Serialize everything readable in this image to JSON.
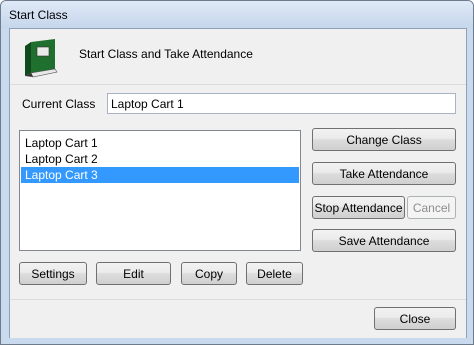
{
  "window": {
    "title": "Start Class"
  },
  "header": {
    "title": "Start Class and Take Attendance",
    "icon": "book-icon"
  },
  "current_class": {
    "label": "Current Class",
    "value": "Laptop Cart 1"
  },
  "class_list": {
    "items": [
      {
        "label": "Laptop Cart 1",
        "selected": false
      },
      {
        "label": "Laptop Cart 2",
        "selected": false
      },
      {
        "label": "Laptop Cart 3",
        "selected": true
      }
    ]
  },
  "actions": {
    "change_class": "Change Class",
    "take_attendance": "Take Attendance",
    "stop_attendance": "Stop Attendance",
    "cancel": "Cancel",
    "save_attendance": "Save Attendance"
  },
  "list_buttons": {
    "settings": "Settings",
    "edit": "Edit",
    "copy": "Copy",
    "delete": "Delete"
  },
  "footer": {
    "close": "Close"
  },
  "colors": {
    "selection": "#3399ff",
    "frame": "#c9d9ee"
  }
}
